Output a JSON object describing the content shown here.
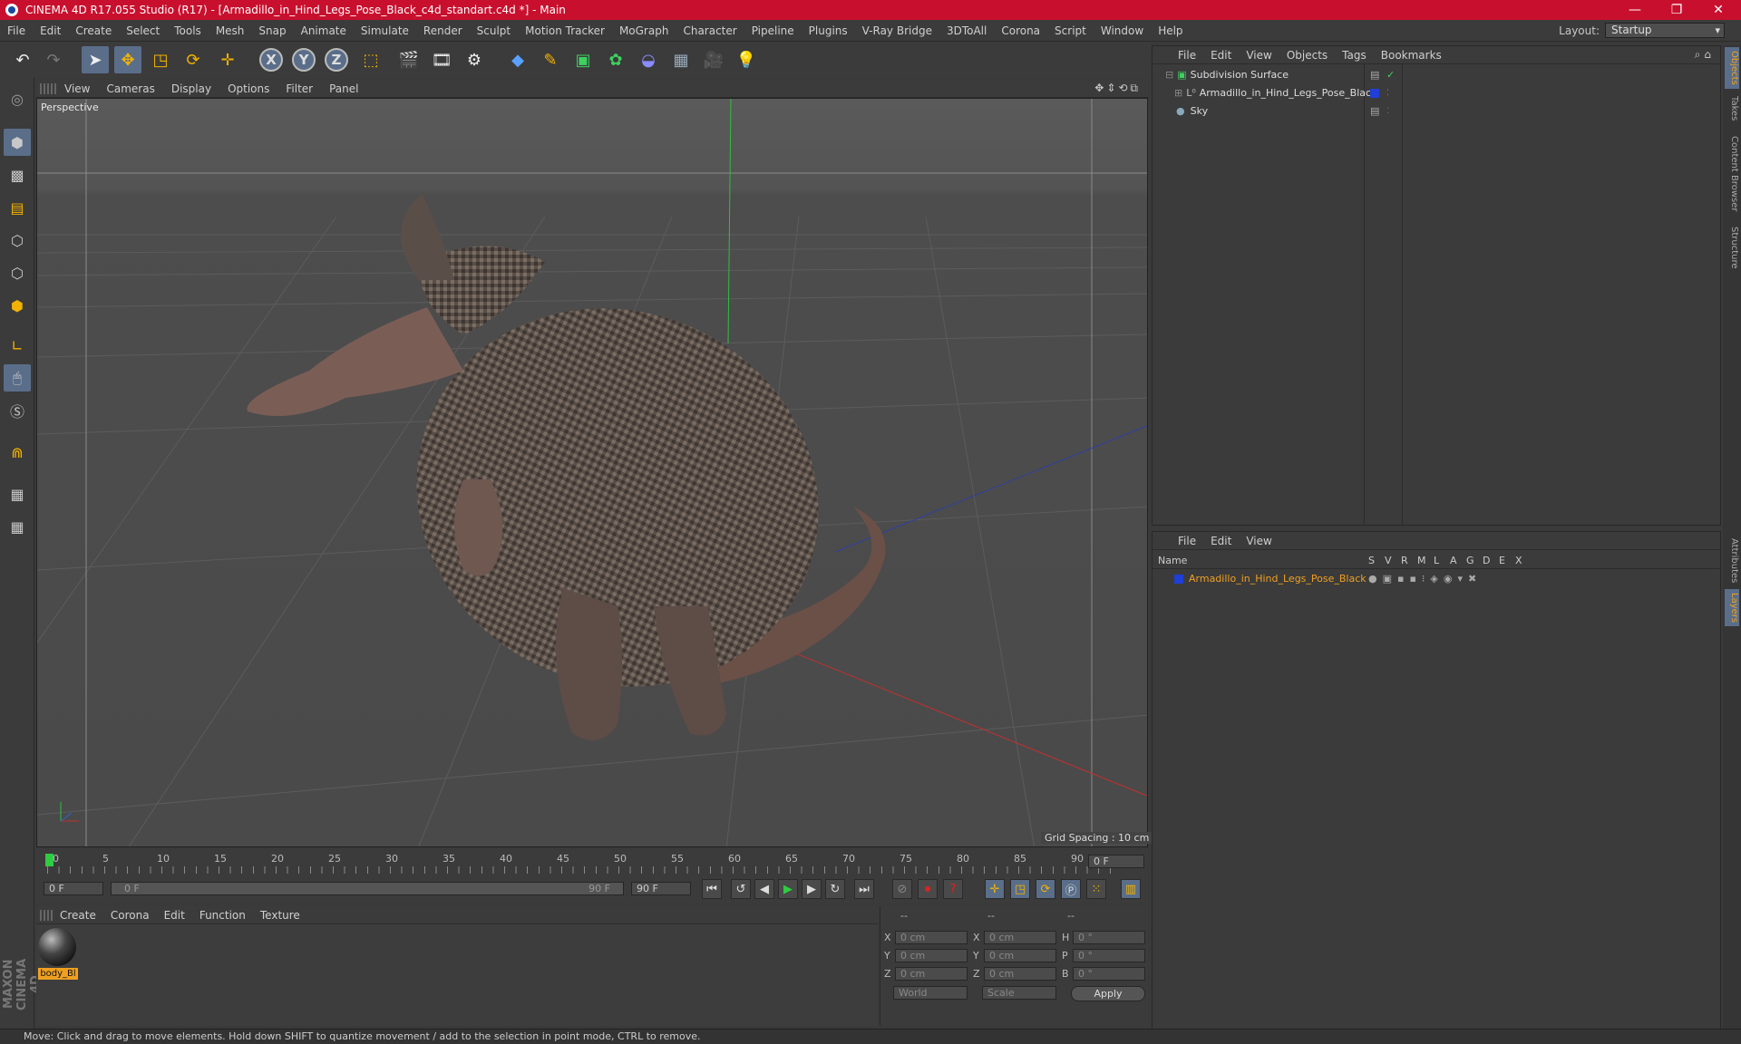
{
  "window": {
    "title": "CINEMA 4D R17.055 Studio (R17) - [Armadillo_in_Hind_Legs_Pose_Black_c4d_standart.c4d *] - Main"
  },
  "menu": [
    "File",
    "Edit",
    "Create",
    "Select",
    "Tools",
    "Mesh",
    "Snap",
    "Animate",
    "Simulate",
    "Render",
    "Sculpt",
    "Motion Tracker",
    "MoGraph",
    "Character",
    "Pipeline",
    "Plugins",
    "V-Ray Bridge",
    "3DToAll",
    "Corona",
    "Script",
    "Window",
    "Help"
  ],
  "layout": {
    "label": "Layout:",
    "value": "Startup"
  },
  "viewport": {
    "menu": [
      "View",
      "Cameras",
      "Display",
      "Options",
      "Filter",
      "Panel"
    ],
    "camera": "Perspective",
    "grid_spacing": "Grid Spacing : 10 cm"
  },
  "timeline": {
    "ticks": [
      "0",
      "5",
      "10",
      "15",
      "20",
      "25",
      "30",
      "35",
      "40",
      "45",
      "50",
      "55",
      "60",
      "65",
      "70",
      "75",
      "80",
      "85",
      "90"
    ],
    "current": "0 F",
    "start": "0 F",
    "slider_start": "0 F",
    "slider_end": "90 F",
    "end": "90 F"
  },
  "materials": {
    "menu": [
      "Create",
      "Corona",
      "Edit",
      "Function",
      "Texture"
    ],
    "items": [
      {
        "name": "body_Bl"
      }
    ]
  },
  "coords": {
    "headers": [
      "--",
      "--",
      "--"
    ],
    "rows": [
      {
        "a": "X",
        "av": "0 cm",
        "b": "X",
        "bv": "0 cm",
        "c": "H",
        "cv": "0 °"
      },
      {
        "a": "Y",
        "av": "0 cm",
        "b": "Y",
        "bv": "0 cm",
        "c": "P",
        "cv": "0 °"
      },
      {
        "a": "Z",
        "av": "0 cm",
        "b": "Z",
        "bv": "0 cm",
        "c": "B",
        "cv": "0 °"
      }
    ],
    "world": "World",
    "scale": "Scale",
    "apply": "Apply"
  },
  "objects": {
    "menu": [
      "File",
      "Edit",
      "View",
      "Objects",
      "Tags",
      "Bookmarks"
    ],
    "items": [
      {
        "name": "Subdivision Surface"
      },
      {
        "name": "Armadillo_in_Hind_Legs_Pose_Black"
      },
      {
        "name": "Sky"
      }
    ]
  },
  "layers": {
    "menu": [
      "File",
      "Edit",
      "View"
    ],
    "columns": [
      "Name",
      "S",
      "V",
      "R",
      "M",
      "L",
      "A",
      "G",
      "D",
      "E",
      "X"
    ],
    "items": [
      {
        "name": "Armadillo_in_Hind_Legs_Pose_Black"
      }
    ]
  },
  "sidetabs": [
    "Objects",
    "Takes",
    "Content Browser",
    "Structure",
    "Attributes",
    "Layers"
  ],
  "brand": "MAXON CINEMA 4D",
  "status": "Move: Click and drag to move elements. Hold down SHIFT to quantize movement / add to the selection in point mode, CTRL to remove.",
  "colors": {
    "title_bar": "#c8102e",
    "layer_name": "#f0a020",
    "layer_swatch": "#1f3fd6",
    "accent_select": "#5a6e8a"
  }
}
